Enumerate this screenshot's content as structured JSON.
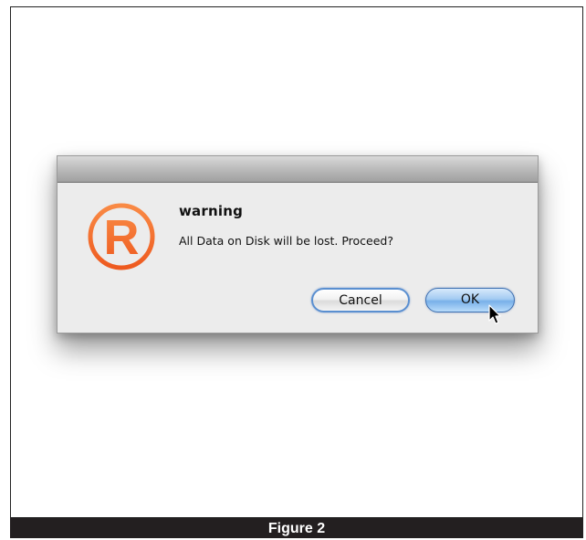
{
  "dialog": {
    "title": "warning",
    "message": "All Data on Disk will be lost. Proceed?",
    "icon": "registered-trademark-icon",
    "buttons": {
      "cancel_label": "Cancel",
      "ok_label": "OK"
    }
  },
  "caption": "Figure 2",
  "colors": {
    "icon_orange": "#f26b2a",
    "default_button_blue": "#8fbfef"
  }
}
